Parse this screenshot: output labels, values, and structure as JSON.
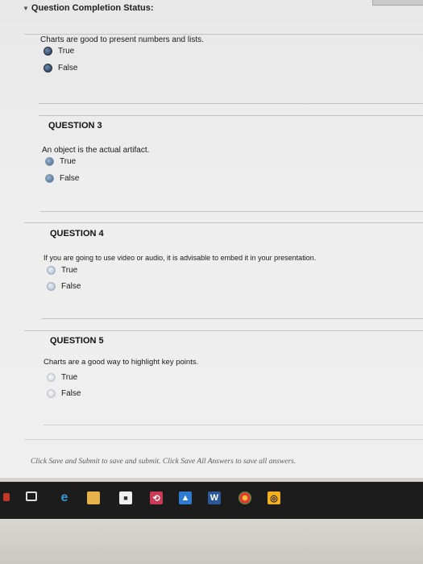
{
  "header": {
    "status_label": "Question Completion Status:"
  },
  "questions": [
    {
      "title": "",
      "text": "Charts are good to present numbers and lists.",
      "options": [
        "True",
        "False"
      ]
    },
    {
      "title": "QUESTION 3",
      "text": "An object is the actual artifact.",
      "options": [
        "True",
        "False"
      ]
    },
    {
      "title": "QUESTION 4",
      "text": "If you are going to use video or audio, it is advisable to embed it in your presentation.",
      "options": [
        "True",
        "False"
      ]
    },
    {
      "title": "QUESTION 5",
      "text": "Charts are a good way to highlight key points.",
      "options": [
        "True",
        "False"
      ]
    }
  ],
  "footer": {
    "note": "Click Save and Submit to save and submit. Click Save All Answers to save all answers."
  },
  "taskbar": {
    "icons": [
      "start-icon",
      "task-view-icon",
      "edge-icon",
      "file-explorer-icon",
      "store-icon",
      "photos-icon",
      "app-icon",
      "word-icon",
      "chrome-icon",
      "camera-icon"
    ]
  },
  "colors": {
    "page_bg": "#eeeeee",
    "taskbar_bg": "#1c1c1c",
    "radio_blue": "#5d7fa3",
    "word_blue": "#2b579a"
  }
}
